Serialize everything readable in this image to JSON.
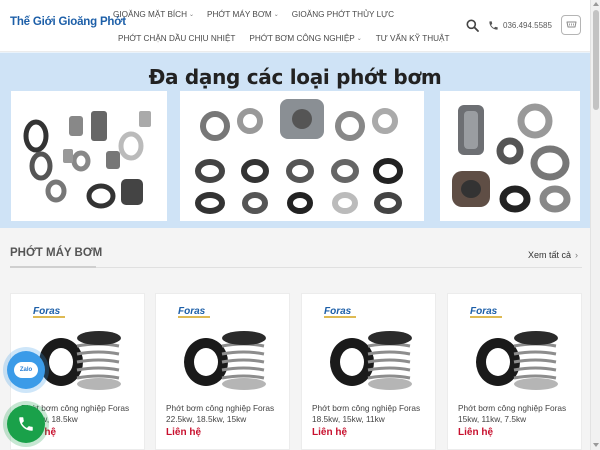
{
  "header": {
    "logo_text": "Thế Giới Gioăng Phớt",
    "nav_row1": [
      {
        "label": "GIOĂNG MẶT BÍCH",
        "has_dropdown": true
      },
      {
        "label": "PHỚT MÁY BƠM",
        "has_dropdown": true
      },
      {
        "label": "GIOĂNG PHỚT THỦY LỰC",
        "has_dropdown": false
      }
    ],
    "nav_row2": [
      {
        "label": "PHỚT CHẶN DẦU CHỊU NHIỆT",
        "has_dropdown": false
      },
      {
        "label": "PHỚT BƠM CÔNG NGHIỆP",
        "has_dropdown": true
      },
      {
        "label": "TƯ VẤN KỸ THUẬT",
        "has_dropdown": false
      }
    ],
    "phone": "036.494.5585",
    "icons": {
      "search": "search-icon",
      "phone": "phone-icon",
      "cart": "cart-icon"
    }
  },
  "banner": {
    "title": "Đa dạng các loại phớt bơm"
  },
  "section": {
    "title": "PHỚT MÁY BƠM",
    "see_all": "Xem tất cả",
    "products": [
      {
        "name": "Phớt bơm công nghiệp Foras 22.5kw, 18.5kw",
        "price": "Liên hệ",
        "brand": "Foras"
      },
      {
        "name": "Phớt bơm công nghiệp Foras 22.5kw, 18.5kw, 15kw",
        "price": "Liên hệ",
        "brand": "Foras"
      },
      {
        "name": "Phớt bơm công nghiệp Foras 18.5kw, 15kw, 11kw",
        "price": "Liên hệ",
        "brand": "Foras"
      },
      {
        "name": "Phớt bơm công nghiệp Foras 15kw, 11kw, 7.5kw",
        "price": "Liên hệ",
        "brand": "Foras"
      }
    ]
  },
  "floating": {
    "zalo_label": "Zalo",
    "icons": {
      "zalo": "zalo-icon",
      "call": "call-icon"
    }
  },
  "colors": {
    "brand_blue": "#1d5fa8",
    "price_red": "#c8102e",
    "banner_bg": "#cfe3f6",
    "zalo_blue": "#3b9be8",
    "call_green": "#1aa14a"
  }
}
